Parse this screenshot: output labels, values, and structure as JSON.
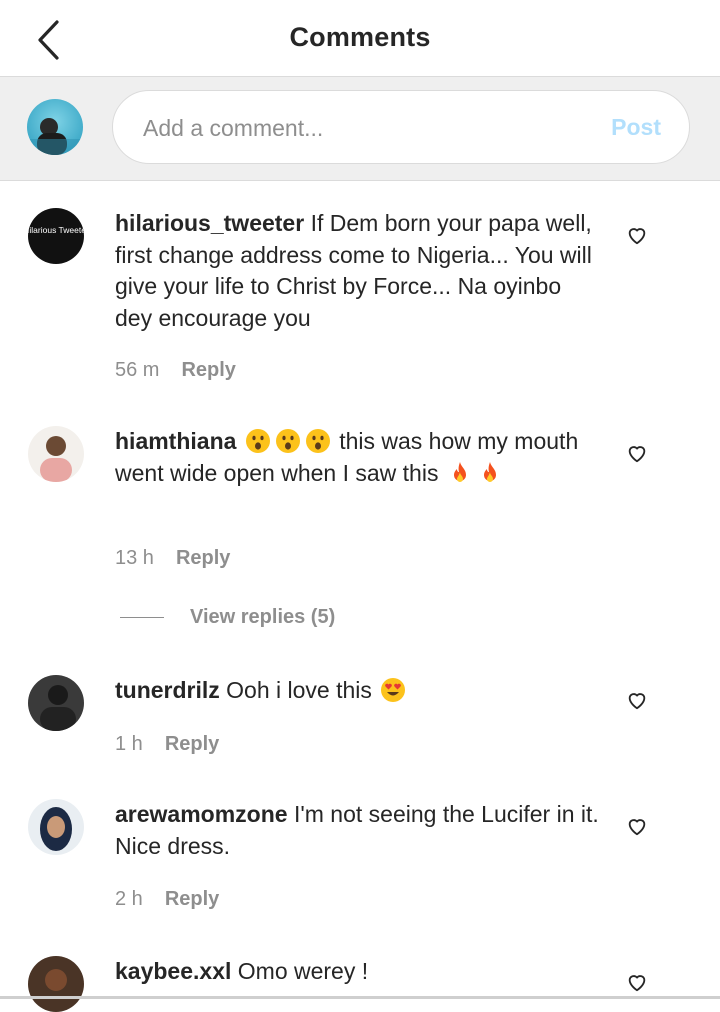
{
  "header": {
    "title": "Comments"
  },
  "composer": {
    "placeholder": "Add a comment...",
    "post_label": "Post"
  },
  "comments": [
    {
      "username": "hilarious_tweeter",
      "text": "If Dem born your papa well, first change address come to Nigeria... You will give your life to Christ by Force... Na oyinbo dey encourage you",
      "time": "56 m",
      "reply": "Reply",
      "avatar_text": "Hilarious Tweeter"
    },
    {
      "username": "hiamthiana",
      "text_after_emoji": "this was how my mouth went wide open when I saw this",
      "time": "13 h",
      "reply": "Reply",
      "view_replies": "View replies (5)"
    },
    {
      "username": "tunerdrilz",
      "text": "Ooh i love this",
      "time": "1 h",
      "reply": "Reply"
    },
    {
      "username": "arewamomzone",
      "text": "I'm not seeing the Lucifer in it. Nice dress.",
      "time": "2 h",
      "reply": "Reply"
    },
    {
      "username": "kaybee.xxl",
      "text": "Omo werey !"
    }
  ],
  "colors": {
    "post_disabled": "#b2dffc",
    "secondary_text": "#8e8e8e",
    "composer_bg": "#efefef"
  }
}
